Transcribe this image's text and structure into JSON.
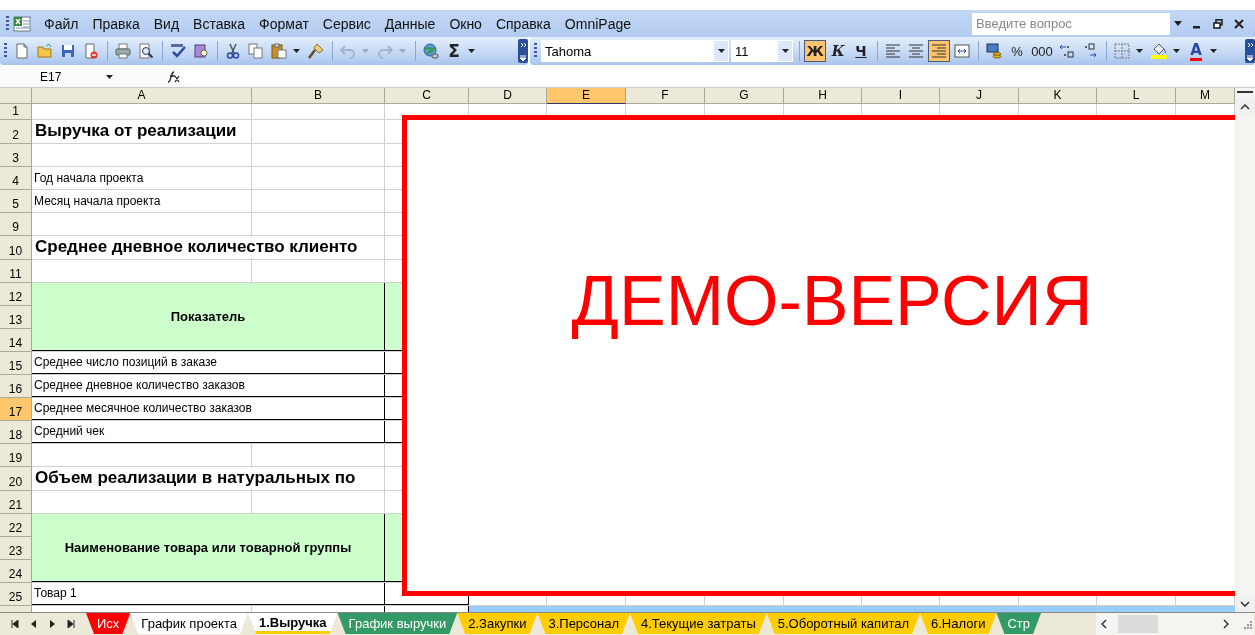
{
  "menu": [
    "Файл",
    "Правка",
    "Вид",
    "Вставка",
    "Формат",
    "Сервис",
    "Данные",
    "Окно",
    "Справка",
    "OmniPage"
  ],
  "help": {
    "placeholder": "Введите вопрос"
  },
  "toolbar": {
    "groups": [
      [
        {
          "kind": "new",
          "disabled": false,
          "dropdown": false
        },
        {
          "kind": "open",
          "disabled": false,
          "dropdown": false
        },
        {
          "kind": "save",
          "disabled": false,
          "dropdown": false
        },
        {
          "kind": "permission",
          "disabled": false,
          "dropdown": false
        }
      ],
      [
        {
          "kind": "print",
          "disabled": false,
          "dropdown": false
        },
        {
          "kind": "preview",
          "disabled": false,
          "dropdown": false
        }
      ],
      [
        {
          "kind": "spelling",
          "disabled": false,
          "dropdown": false
        },
        {
          "kind": "research",
          "disabled": false,
          "dropdown": false
        }
      ],
      [
        {
          "kind": "cut",
          "disabled": false,
          "dropdown": false
        },
        {
          "kind": "copy",
          "disabled": false,
          "dropdown": false
        },
        {
          "kind": "paste",
          "disabled": false,
          "dropdown": true
        },
        {
          "kind": "brush",
          "disabled": false,
          "dropdown": false
        }
      ],
      [
        {
          "kind": "undo",
          "disabled": true,
          "dropdown": true
        },
        {
          "kind": "redo",
          "disabled": true,
          "dropdown": true
        }
      ],
      [
        {
          "kind": "hyperlink",
          "disabled": false,
          "dropdown": false
        },
        {
          "kind": "sum",
          "label": "Σ",
          "disabled": false,
          "dropdown": true
        }
      ]
    ]
  },
  "font": {
    "name": "Tahoma",
    "size": "11"
  },
  "formatting": {
    "groups": [
      [
        {
          "kind": "bold",
          "label": "Ж",
          "on": true,
          "dropdown": false
        },
        {
          "kind": "italic",
          "label": "К",
          "on": false,
          "dropdown": false
        },
        {
          "kind": "underline",
          "label": "Ч",
          "on": false,
          "dropdown": false
        }
      ],
      [
        {
          "kind": "align-left",
          "on": false,
          "dropdown": false
        },
        {
          "kind": "align-center",
          "on": false,
          "dropdown": false
        },
        {
          "kind": "align-right",
          "on": true,
          "dropdown": false
        },
        {
          "kind": "merge",
          "on": false,
          "dropdown": false
        }
      ],
      [
        {
          "kind": "currency",
          "on": false,
          "dropdown": false
        },
        {
          "kind": "percent",
          "label": "%",
          "on": false,
          "dropdown": false
        },
        {
          "kind": "thousands",
          "label": "000",
          "on": false,
          "dropdown": false
        },
        {
          "kind": "increase-decimal",
          "on": false,
          "dropdown": false
        },
        {
          "kind": "decrease-decimal",
          "on": false,
          "dropdown": false
        }
      ],
      [
        {
          "kind": "borders",
          "on": false,
          "dropdown": true
        },
        {
          "kind": "fill",
          "on": false,
          "dropdown": true
        },
        {
          "kind": "font-color",
          "label": "A",
          "on": false,
          "dropdown": true
        }
      ]
    ]
  },
  "name_box": "E17",
  "sheet": {
    "columns": [
      {
        "label": "A",
        "selected": false
      },
      {
        "label": "B",
        "selected": false
      },
      {
        "label": "C",
        "selected": false
      },
      {
        "label": "D",
        "selected": false
      },
      {
        "label": "E",
        "selected": true
      },
      {
        "label": "F",
        "selected": false
      },
      {
        "label": "G",
        "selected": false
      },
      {
        "label": "H",
        "selected": false
      },
      {
        "label": "I",
        "selected": false
      },
      {
        "label": "J",
        "selected": false
      },
      {
        "label": "K",
        "selected": false
      },
      {
        "label": "L",
        "selected": false
      },
      {
        "label": "M",
        "selected": false
      }
    ],
    "blocks": [
      {
        "kind": "spacer",
        "rows": [
          {
            "number": "1",
            "selected": false
          }
        ]
      },
      {
        "kind": "title",
        "text": "Выручка от реализации",
        "rows": [
          {
            "number": "2",
            "selected": false
          }
        ]
      },
      {
        "kind": "blank",
        "rows": [
          {
            "number": "3",
            "selected": false
          }
        ]
      },
      {
        "kind": "label",
        "text": "Год начала проекта",
        "rows": [
          {
            "number": "4",
            "selected": false
          }
        ]
      },
      {
        "kind": "label",
        "text": "Месяц начала проекта",
        "rows": [
          {
            "number": "5",
            "selected": false
          }
        ]
      },
      {
        "kind": "blank",
        "rows": [
          {
            "number": "9",
            "selected": false
          }
        ]
      },
      {
        "kind": "title",
        "text": "Среднее дневное количество клиенто",
        "rows": [
          {
            "number": "10",
            "selected": false
          }
        ]
      },
      {
        "kind": "blank",
        "rows": [
          {
            "number": "11",
            "selected": false
          }
        ]
      },
      {
        "kind": "header",
        "text": "Показатель",
        "rows": [
          {
            "number": "12",
            "selected": false
          },
          {
            "number": "13",
            "selected": false
          },
          {
            "number": "14",
            "selected": false
          }
        ]
      },
      {
        "kind": "item",
        "text": "Среднее число позиций в заказе",
        "rows": [
          {
            "number": "15",
            "selected": false
          }
        ]
      },
      {
        "kind": "item",
        "text": "Среднее дневное количество  заказов",
        "rows": [
          {
            "number": "16",
            "selected": false
          }
        ]
      },
      {
        "kind": "item",
        "text": "Среднее месячное количество  заказов",
        "rows": [
          {
            "number": "17",
            "selected": true
          }
        ]
      },
      {
        "kind": "item",
        "text": "Средний чек",
        "rows": [
          {
            "number": "18",
            "selected": false
          }
        ]
      },
      {
        "kind": "blank",
        "rows": [
          {
            "number": "19",
            "selected": false
          }
        ]
      },
      {
        "kind": "title",
        "text": "Объем реализации в натуральных по",
        "rows": [
          {
            "number": "20",
            "selected": false
          }
        ]
      },
      {
        "kind": "blank",
        "rows": [
          {
            "number": "21",
            "selected": false
          }
        ]
      },
      {
        "kind": "header",
        "text": "Наименование товара или товарной группы",
        "rows": [
          {
            "number": "22",
            "selected": false
          },
          {
            "number": "23",
            "selected": false
          },
          {
            "number": "24",
            "selected": false
          }
        ]
      },
      {
        "kind": "item",
        "text": "Товар 1",
        "rows": [
          {
            "number": "25",
            "selected": false
          }
        ]
      },
      {
        "kind": "data",
        "rows": [
          {
            "selected": false
          }
        ]
      }
    ],
    "overlay": "ДЕМО-ВЕРСИЯ"
  },
  "tabs": [
    {
      "label": "Исх",
      "color": "#ff0000",
      "selected": false
    },
    {
      "label": "График проекта",
      "color": "#ffffff",
      "selected": false
    },
    {
      "label": "1.Выручка",
      "color": "#ffcc00",
      "selected": true
    },
    {
      "label": "График выручки",
      "color": "#339966",
      "selected": false
    },
    {
      "label": "2.Закупки",
      "color": "#ffcc00",
      "selected": false
    },
    {
      "label": "3.Персонал",
      "color": "#ffcc00",
      "selected": false
    },
    {
      "label": "4.Текущие затраты",
      "color": "#ffcc00",
      "selected": false
    },
    {
      "label": "5.Оборотный капитал",
      "color": "#ffcc00",
      "selected": false
    },
    {
      "label": "6.Налоги",
      "color": "#ffcc00",
      "selected": false
    },
    {
      "label": "Стр",
      "color": "#339966",
      "selected": false
    }
  ]
}
